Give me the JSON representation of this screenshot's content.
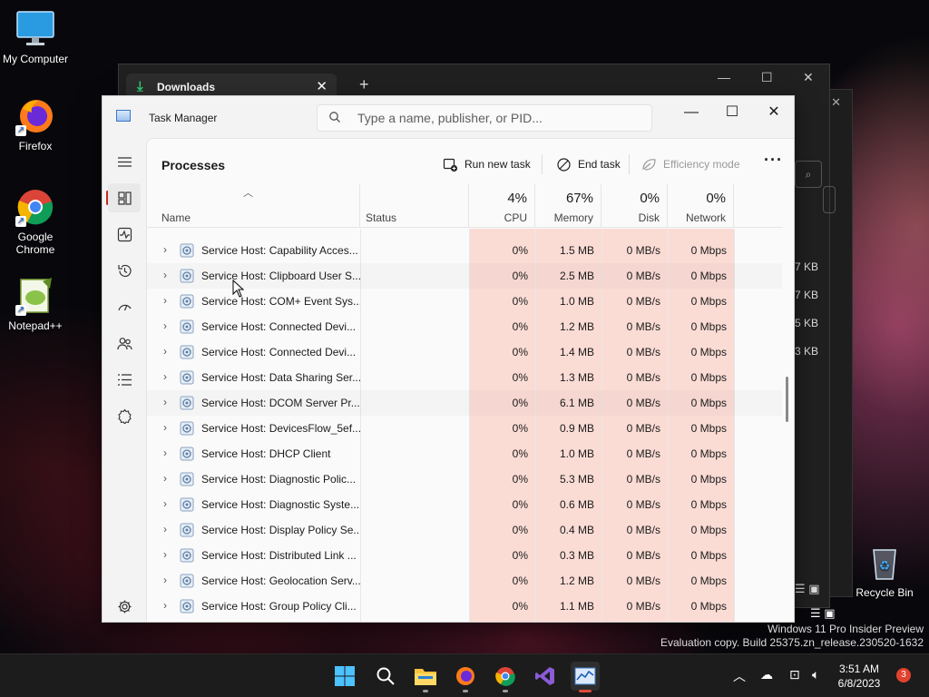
{
  "desktop": {
    "icons": [
      {
        "label": "My Computer",
        "icon": "monitor-icon"
      },
      {
        "label": "Firefox",
        "icon": "firefox-icon"
      },
      {
        "label": "Google Chrome",
        "icon": "chrome-icon"
      },
      {
        "label": "Notepad++",
        "icon": "notepadpp-icon"
      },
      {
        "label": "Recycle Bin",
        "icon": "recycle-bin-icon"
      }
    ],
    "watermark_line1": "Windows 11 Pro Insider Preview",
    "watermark_line2": "Evaluation copy. Build 25375.zn_release.230520-1632"
  },
  "background_window": {
    "tab_title": "Downloads",
    "sizes": [
      "7 KB",
      "7 KB",
      "5 KB",
      "3 KB"
    ]
  },
  "task_manager": {
    "title": "Task Manager",
    "search_placeholder": "Type a name, publisher, or PID...",
    "page_title": "Processes",
    "commands": {
      "run_new_task": "Run new task",
      "end_task": "End task",
      "efficiency_mode": "Efficiency mode"
    },
    "columns": {
      "name": "Name",
      "status": "Status",
      "cpu": {
        "label": "CPU",
        "pct": "4%"
      },
      "memory": {
        "label": "Memory",
        "pct": "67%"
      },
      "disk": {
        "label": "Disk",
        "pct": "0%"
      },
      "network": {
        "label": "Network",
        "pct": "0%"
      }
    },
    "rows": [
      {
        "name": "Service Host: Capability Acces...",
        "status": "",
        "cpu": "0%",
        "memory": "1.5 MB",
        "disk": "0 MB/s",
        "network": "0 Mbps"
      },
      {
        "name": "Service Host: Clipboard User S...",
        "status": "",
        "cpu": "0%",
        "memory": "2.5 MB",
        "disk": "0 MB/s",
        "network": "0 Mbps"
      },
      {
        "name": "Service Host: COM+ Event Sys...",
        "status": "",
        "cpu": "0%",
        "memory": "1.0 MB",
        "disk": "0 MB/s",
        "network": "0 Mbps"
      },
      {
        "name": "Service Host: Connected Devi...",
        "status": "",
        "cpu": "0%",
        "memory": "1.2 MB",
        "disk": "0 MB/s",
        "network": "0 Mbps"
      },
      {
        "name": "Service Host: Connected Devi...",
        "status": "",
        "cpu": "0%",
        "memory": "1.4 MB",
        "disk": "0 MB/s",
        "network": "0 Mbps"
      },
      {
        "name": "Service Host: Data Sharing Ser...",
        "status": "",
        "cpu": "0%",
        "memory": "1.3 MB",
        "disk": "0 MB/s",
        "network": "0 Mbps"
      },
      {
        "name": "Service Host: DCOM Server Pr...",
        "status": "",
        "cpu": "0%",
        "memory": "6.1 MB",
        "disk": "0 MB/s",
        "network": "0 Mbps"
      },
      {
        "name": "Service Host: DevicesFlow_5ef...",
        "status": "",
        "cpu": "0%",
        "memory": "0.9 MB",
        "disk": "0 MB/s",
        "network": "0 Mbps"
      },
      {
        "name": "Service Host: DHCP Client",
        "status": "",
        "cpu": "0%",
        "memory": "1.0 MB",
        "disk": "0 MB/s",
        "network": "0 Mbps"
      },
      {
        "name": "Service Host: Diagnostic Polic...",
        "status": "",
        "cpu": "0%",
        "memory": "5.3 MB",
        "disk": "0 MB/s",
        "network": "0 Mbps"
      },
      {
        "name": "Service Host: Diagnostic Syste...",
        "status": "",
        "cpu": "0%",
        "memory": "0.6 MB",
        "disk": "0 MB/s",
        "network": "0 Mbps"
      },
      {
        "name": "Service Host: Display Policy Se...",
        "status": "",
        "cpu": "0%",
        "memory": "0.4 MB",
        "disk": "0 MB/s",
        "network": "0 Mbps"
      },
      {
        "name": "Service Host: Distributed Link ...",
        "status": "",
        "cpu": "0%",
        "memory": "0.3 MB",
        "disk": "0 MB/s",
        "network": "0 Mbps"
      },
      {
        "name": "Service Host: Geolocation Serv...",
        "status": "",
        "cpu": "0%",
        "memory": "1.2 MB",
        "disk": "0 MB/s",
        "network": "0 Mbps"
      },
      {
        "name": "Service Host: Group Policy Cli...",
        "status": "",
        "cpu": "0%",
        "memory": "1.1 MB",
        "disk": "0 MB/s",
        "network": "0 Mbps"
      }
    ]
  },
  "taskbar": {
    "time": "3:51 AM",
    "date": "6/8/2023",
    "notification_count": "3"
  }
}
